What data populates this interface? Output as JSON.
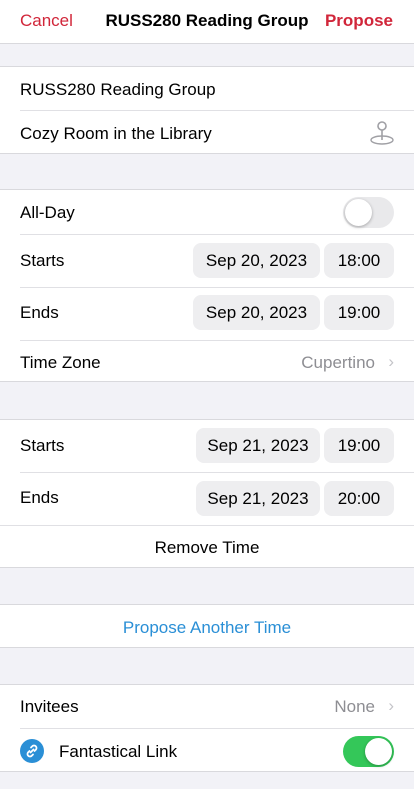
{
  "nav": {
    "cancel": "Cancel",
    "title": "RUSS280 Reading Group",
    "propose": "Propose"
  },
  "event": {
    "title": "RUSS280 Reading Group",
    "location": "Cozy Room in the Library",
    "location_icon": "map-pin-icon"
  },
  "timing": {
    "all_day_label": "All-Day",
    "all_day_on": false,
    "starts_label": "Starts",
    "starts_date": "Sep 20, 2023",
    "starts_time": "18:00",
    "ends_label": "Ends",
    "ends_date": "Sep 20, 2023",
    "ends_time": "19:00",
    "timezone_label": "Time Zone",
    "timezone_value": "Cupertino"
  },
  "proposal": {
    "starts_label": "Starts",
    "starts_date": "Sep 21, 2023",
    "starts_time": "19:00",
    "ends_label": "Ends",
    "ends_date": "Sep 21, 2023",
    "ends_time": "20:00",
    "remove_label": "Remove Time"
  },
  "propose_another": "Propose Another Time",
  "invitees": {
    "label": "Invitees",
    "value": "None"
  },
  "fantastical": {
    "label": "Fantastical Link",
    "on": true
  },
  "colors": {
    "accent_red": "#d1263a",
    "link_blue": "#2a8fd6",
    "toggle_green": "#34c759",
    "toggle_off": "#e9e9eb"
  }
}
